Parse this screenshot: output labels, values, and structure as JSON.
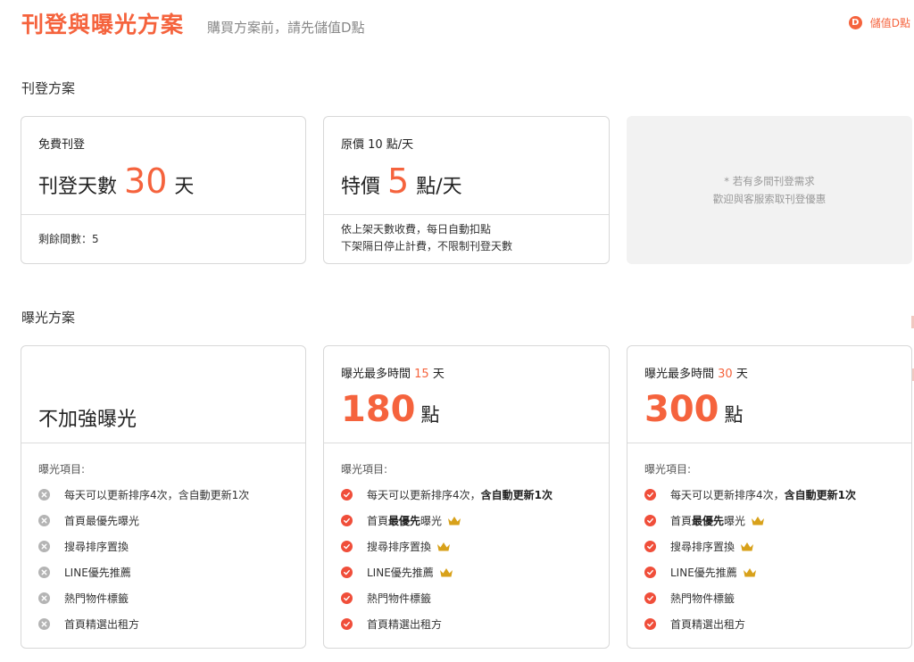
{
  "header": {
    "title": "刊登與曝光方案",
    "subtitle": "購買方案前，請先儲值D點",
    "topup_icon": "D",
    "topup_label": "儲值D點"
  },
  "listing": {
    "section_title": "刊登方案",
    "free": {
      "label": "免費刊登",
      "pre": "刊登天數",
      "number": "30",
      "post": "天",
      "remaining": "剩餘間數：5"
    },
    "paid": {
      "label": "原價 10 點/天",
      "pre": "特價",
      "number": "5",
      "post": "點/天",
      "desc_line1": "依上架天數收費，每日自動扣點",
      "desc_line2": "下架隔日停止計費，不限制刊登天數"
    },
    "note": {
      "line1": "* 若有多間刊登需求",
      "line2": "歡迎與客服索取刊登優惠"
    }
  },
  "exposure": {
    "section_title": "曝光方案",
    "features_title": "曝光項目:",
    "plans": [
      {
        "name": "不加強曝光",
        "features": [
          {
            "text": "每天可以更新排序4次，含自動更新1次",
            "included": false
          },
          {
            "text": "首頁最優先曝光",
            "included": false
          },
          {
            "text": "搜尋排序置換",
            "included": false
          },
          {
            "text": "LINE優先推薦",
            "included": false
          },
          {
            "text": "熱門物件標籤",
            "included": false
          },
          {
            "text": "首頁精選出租方",
            "included": false
          }
        ]
      },
      {
        "head_pre": "曝光最多時間",
        "head_days": "15",
        "head_post": "天",
        "price": "180",
        "unit": "點",
        "features": [
          {
            "text_a": "每天可以更新排序4次，",
            "text_b": "含自動更新1次",
            "included": true
          },
          {
            "text_a": "首頁",
            "text_b": "最優先",
            "text_c": "曝光",
            "included": true,
            "crown": true
          },
          {
            "text": "搜尋排序置換",
            "included": true,
            "crown": true
          },
          {
            "text": "LINE優先推薦",
            "included": true,
            "crown": true
          },
          {
            "text": "熱門物件標籤",
            "included": true
          },
          {
            "text": "首頁精選出租方",
            "included": true
          }
        ]
      },
      {
        "head_pre": "曝光最多時間",
        "head_days": "30",
        "head_post": "天",
        "price": "300",
        "unit": "點",
        "features": [
          {
            "text_a": "每天可以更新排序4次，",
            "text_b": "含自動更新1次",
            "included": true
          },
          {
            "text_a": "首頁",
            "text_b": "最優先",
            "text_c": "曝光",
            "included": true,
            "crown": true
          },
          {
            "text": "搜尋排序置換",
            "included": true,
            "crown": true
          },
          {
            "text": "LINE優先推薦",
            "included": true,
            "crown": true
          },
          {
            "text": "熱門物件標籤",
            "included": true
          },
          {
            "text": "首頁精選出租方",
            "included": true
          }
        ]
      }
    ]
  },
  "colors": {
    "accent": "#f5633d",
    "check": "#f04e3a",
    "disabled": "#b4b4b4",
    "crown": "#d8a11a"
  }
}
